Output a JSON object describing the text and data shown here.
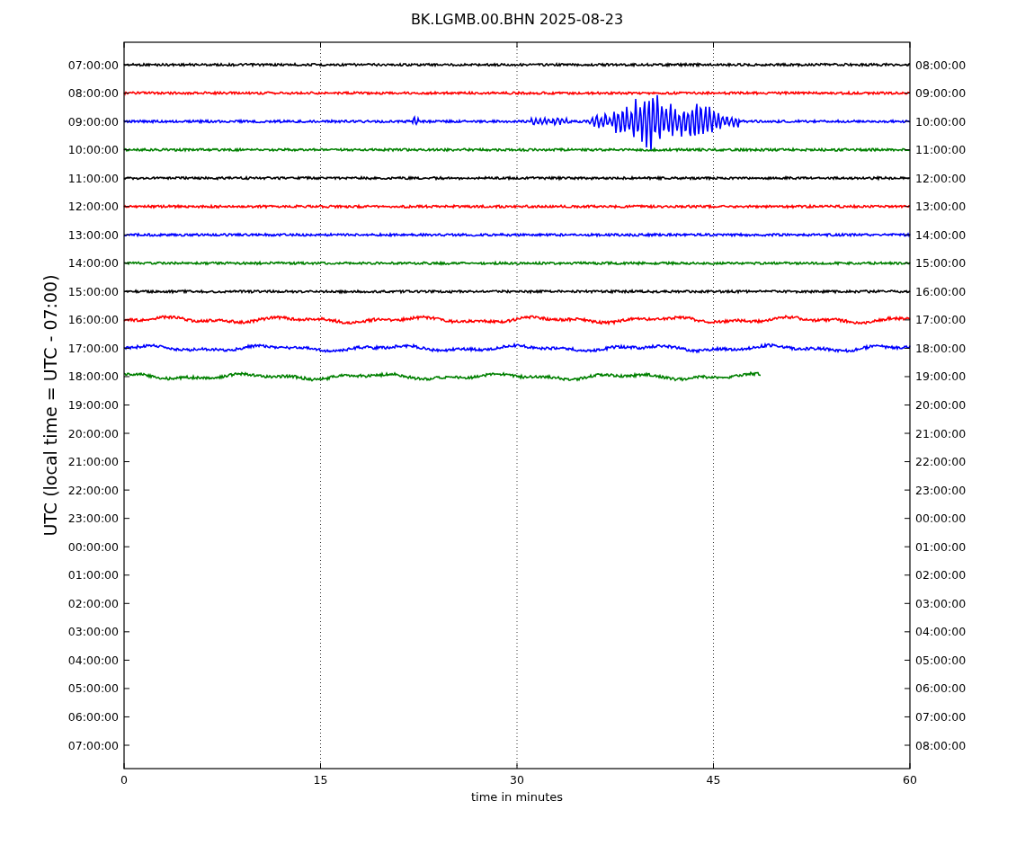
{
  "plot": {
    "title": "BK.LGMB.00.BHN 2025-08-23",
    "ylabel": "UTC (local time = UTC - 07:00)",
    "xlabel": "time in minutes",
    "xticks": [
      "0",
      "15",
      "30",
      "45",
      "60"
    ],
    "left_labels": [
      "07:00:00",
      "08:00:00",
      "09:00:00",
      "10:00:00",
      "11:00:00",
      "12:00:00",
      "13:00:00",
      "14:00:00",
      "15:00:00",
      "16:00:00",
      "17:00:00",
      "18:00:00",
      "19:00:00",
      "20:00:00",
      "21:00:00",
      "22:00:00",
      "23:00:00",
      "00:00:00",
      "01:00:00",
      "02:00:00",
      "03:00:00",
      "04:00:00",
      "05:00:00",
      "06:00:00",
      "07:00:00"
    ],
    "right_labels": [
      "08:00:00",
      "09:00:00",
      "10:00:00",
      "11:00:00",
      "12:00:00",
      "13:00:00",
      "14:00:00",
      "15:00:00",
      "16:00:00",
      "17:00:00",
      "18:00:00",
      "19:00:00",
      "20:00:00",
      "21:00:00",
      "22:00:00",
      "23:00:00",
      "00:00:00",
      "01:00:00",
      "02:00:00",
      "03:00:00",
      "04:00:00",
      "05:00:00",
      "06:00:00",
      "07:00:00",
      "08:00:00"
    ],
    "traces": [
      {
        "color": "#000000",
        "kind": "quiet",
        "level": 1
      },
      {
        "color": "#ff0000",
        "kind": "quiet",
        "level": 1
      },
      {
        "color": "#0000ff",
        "kind": "event",
        "level": 1
      },
      {
        "color": "#008000",
        "kind": "quiet",
        "level": 1
      },
      {
        "color": "#000000",
        "kind": "quiet",
        "level": 1
      },
      {
        "color": "#ff0000",
        "kind": "quiet",
        "level": 1
      },
      {
        "color": "#0000ff",
        "kind": "quiet",
        "level": 1
      },
      {
        "color": "#008000",
        "kind": "quiet",
        "level": 1
      },
      {
        "color": "#000000",
        "kind": "quiet",
        "level": 1
      },
      {
        "color": "#ff0000",
        "kind": "swell",
        "level": 1
      },
      {
        "color": "#0000ff",
        "kind": "swell",
        "level": 1
      },
      {
        "color": "#008000",
        "kind": "swell",
        "level": 0.81
      }
    ]
  }
}
